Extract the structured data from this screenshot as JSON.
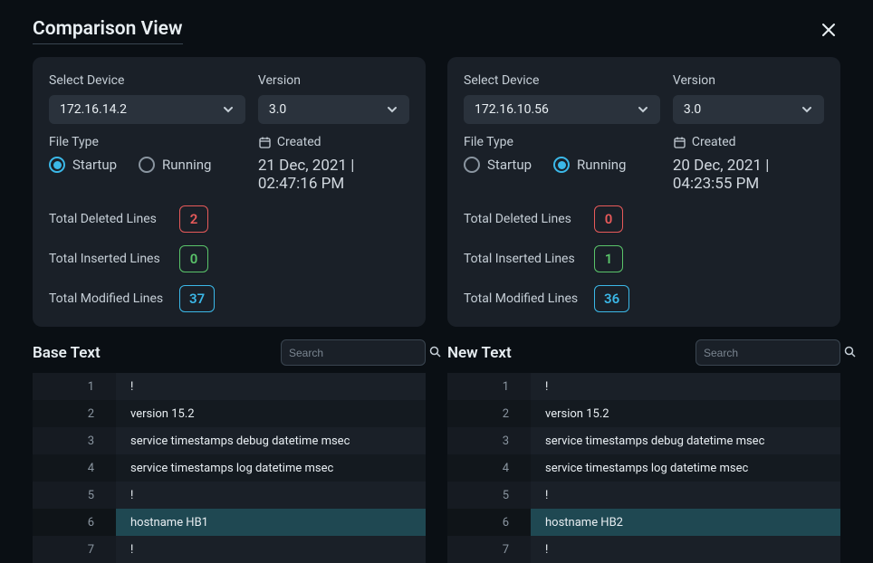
{
  "header": {
    "title": "Comparison View"
  },
  "left": {
    "device_label": "Select Device",
    "device_value": "172.16.14.2",
    "version_label": "Version",
    "version_value": "3.0",
    "file_type_label": "File Type",
    "created_label": "Created",
    "created_value": "21 Dec, 2021 | 02:47:16 PM",
    "radio_startup": "Startup",
    "radio_running": "Running",
    "radio_selected": "startup",
    "deleted_label": "Total Deleted Lines",
    "deleted_value": "2",
    "inserted_label": "Total Inserted Lines",
    "inserted_value": "0",
    "modified_label": "Total Modified Lines",
    "modified_value": "37"
  },
  "right": {
    "device_label": "Select Device",
    "device_value": "172.16.10.56",
    "version_label": "Version",
    "version_value": "3.0",
    "file_type_label": "File Type",
    "created_label": "Created",
    "created_value": "20 Dec, 2021 | 04:23:55 PM",
    "radio_startup": "Startup",
    "radio_running": "Running",
    "radio_selected": "running",
    "deleted_label": "Total Deleted Lines",
    "deleted_value": "0",
    "inserted_label": "Total Inserted Lines",
    "inserted_value": "1",
    "modified_label": "Total Modified Lines",
    "modified_value": "36"
  },
  "base": {
    "title": "Base Text",
    "search_placeholder": "Search",
    "lines": [
      {
        "n": "1",
        "t": "!",
        "hl": false
      },
      {
        "n": "2",
        "t": "version 15.2",
        "hl": false
      },
      {
        "n": "3",
        "t": "service timestamps debug datetime msec",
        "hl": false
      },
      {
        "n": "4",
        "t": "service timestamps log datetime msec",
        "hl": false
      },
      {
        "n": "5",
        "t": "!",
        "hl": false
      },
      {
        "n": "6",
        "t": "hostname HB1",
        "hl": true
      },
      {
        "n": "7",
        "t": "!",
        "hl": false
      }
    ]
  },
  "new": {
    "title": "New Text",
    "search_placeholder": "Search",
    "lines": [
      {
        "n": "1",
        "t": "!",
        "hl": false
      },
      {
        "n": "2",
        "t": "version 15.2",
        "hl": false
      },
      {
        "n": "3",
        "t": "service timestamps debug datetime msec",
        "hl": false
      },
      {
        "n": "4",
        "t": "service timestamps log datetime msec",
        "hl": false
      },
      {
        "n": "5",
        "t": "!",
        "hl": false
      },
      {
        "n": "6",
        "t": "hostname HB2",
        "hl": true
      },
      {
        "n": "7",
        "t": "!",
        "hl": false
      }
    ]
  }
}
